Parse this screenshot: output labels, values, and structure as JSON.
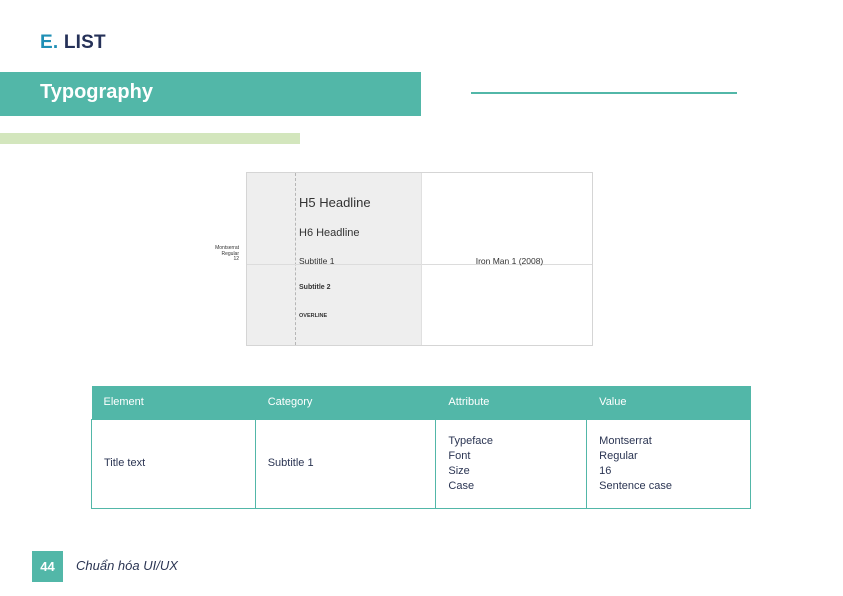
{
  "header": {
    "section_letter": "E.",
    "section_name": "LIST"
  },
  "banner": {
    "title": "Typography"
  },
  "preview": {
    "annotation": [
      "Montserrat",
      "Regular",
      "12"
    ],
    "styles": {
      "h5": "H5 Headline",
      "h6": "H6 Headline",
      "subtitle1": "Subtitle 1",
      "subtitle2": "Subtitle 2",
      "overline": "OVERLINE"
    },
    "sample_text": "Iron Man 1 (2008)"
  },
  "table": {
    "headers": [
      "Element",
      "Category",
      "Attribute",
      "Value"
    ],
    "row": {
      "element": "Title text",
      "category": "Subtitle 1",
      "attributes": [
        "Typeface",
        "Font",
        "Size",
        "Case"
      ],
      "values": [
        "Montserrat",
        "Regular",
        "16",
        "Sentence case"
      ]
    }
  },
  "footer": {
    "page_number": "44",
    "text": "Chuẩn hóa UI/UX"
  },
  "colors": {
    "teal": "#52b7a8",
    "green_light": "#d3e6bd",
    "blue": "#1f8fb5",
    "navy": "#253158"
  }
}
